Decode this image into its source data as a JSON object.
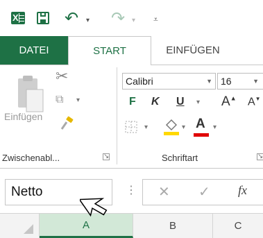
{
  "qat": {
    "app_icon": "excel-icon",
    "save_icon": "save-icon",
    "undo_icon": "undo-icon",
    "redo_icon": "redo-icon",
    "customize_icon": "customize-qat-icon",
    "app_letter": "X"
  },
  "tabs": [
    {
      "label": "DATEI"
    },
    {
      "label": "START"
    },
    {
      "label": "EINFÜGEN"
    }
  ],
  "clipboard": {
    "paste_label": "Einfügen",
    "group_label": "Zwischenabl...",
    "icons": [
      "paste-icon",
      "cut-icon",
      "copy-icon",
      "format-painter-icon"
    ]
  },
  "font": {
    "font_name": "Calibri",
    "font_size": "16",
    "bold": "F",
    "italic": "K",
    "underline": "U",
    "grow": "A",
    "shrink": "A",
    "color_letter": "A",
    "group_label": "Schriftart",
    "colors": {
      "fill": "#ffd800",
      "font": "#e00000"
    }
  },
  "formula_bar": {
    "name_box": "Netto",
    "fx": "fx"
  },
  "columns": [
    "A",
    "B",
    "C"
  ],
  "colors": {
    "accent": "#1e7145",
    "selected_col": "#d2e8d7"
  }
}
